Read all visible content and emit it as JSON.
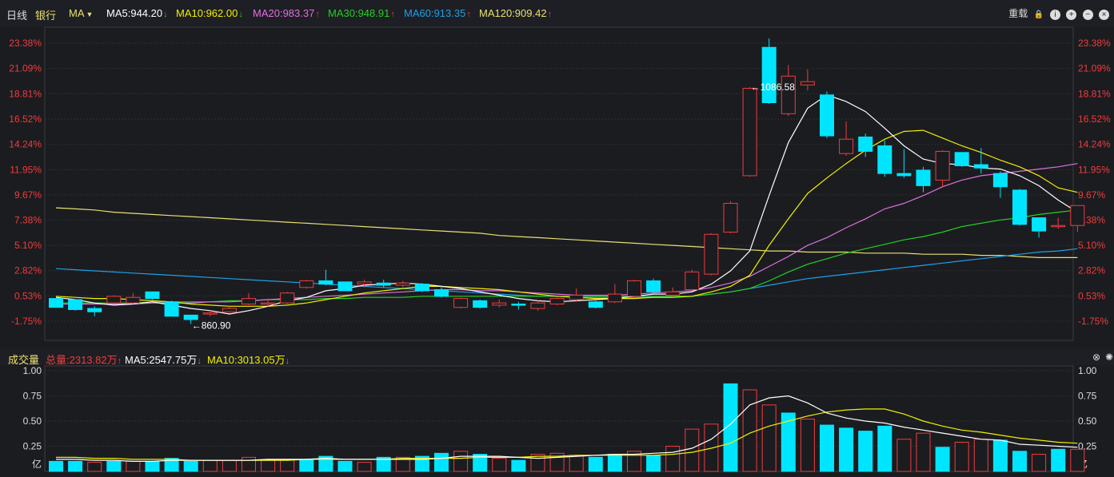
{
  "header": {
    "period": "日线",
    "sector": "银行",
    "indicator": "MA",
    "ma": [
      {
        "label": "MA5:944.20",
        "color": "#ffffff",
        "arrow": "↓",
        "dir": "dn"
      },
      {
        "label": "MA10:962.00",
        "color": "#f0f000",
        "arrow": "↓",
        "dir": "dn"
      },
      {
        "label": "MA20:983.37",
        "color": "#e070e0",
        "arrow": "↑",
        "dir": "up"
      },
      {
        "label": "MA30:948.91",
        "color": "#23d023",
        "arrow": "↑",
        "dir": "up"
      },
      {
        "label": "MA60:913.35",
        "color": "#1ea0e6",
        "arrow": "↑",
        "dir": "up"
      },
      {
        "label": "MA120:909.42",
        "color": "#e8e070",
        "arrow": "↑",
        "dir": "up"
      }
    ],
    "reload_label": "重载"
  },
  "volume_header": {
    "title": "成交量",
    "total": "总量:2313.82万",
    "total_arrow": "↑",
    "ma5": "MA5:2547.75万",
    "ma5_arrow": "↓",
    "ma10": "MA10:3013.05万",
    "ma10_arrow": "↓",
    "unit": "亿"
  },
  "colors": {
    "up": "#f03c3c",
    "down": "#00e5ff",
    "ma5": "#ffffff",
    "ma10": "#f0f000",
    "ma20": "#e070e0",
    "ma30": "#23d023",
    "ma60": "#1ea0e6",
    "ma120": "#e8e070"
  },
  "chart_data": [
    {
      "type": "candlestick",
      "y_ticks": [
        "23.38%",
        "21.09%",
        "18.81%",
        "16.52%",
        "14.24%",
        "11.95%",
        "9.67%",
        "7.38%",
        "5.10%",
        "2.82%",
        "0.53%",
        "-1.75%"
      ],
      "ylim_pct": [
        -3,
        26.5
      ],
      "annotations": [
        {
          "label": "←1086.58",
          "index": 36
        },
        {
          "label": "←860.90",
          "index": 7
        }
      ],
      "candles": [
        {
          "o": 0.3,
          "c": -0.5,
          "h": 0.3,
          "l": -0.5
        },
        {
          "o": 0.2,
          "c": -0.7,
          "h": 0.2,
          "l": -0.8
        },
        {
          "o": -0.6,
          "c": -0.9,
          "h": -0.4,
          "l": -1.3
        },
        {
          "o": -0.1,
          "c": 0.5,
          "h": 0.6,
          "l": -0.1
        },
        {
          "o": -0.1,
          "c": 0.4,
          "h": 0.8,
          "l": -0.2
        },
        {
          "o": 0.9,
          "c": 0.3,
          "h": 0.9,
          "l": 0.2
        },
        {
          "o": 0.0,
          "c": -1.3,
          "h": 0.1,
          "l": -1.3
        },
        {
          "o": -1.2,
          "c": -1.6,
          "h": -1.2,
          "l": -2.0
        },
        {
          "o": -1.1,
          "c": -1.0,
          "h": -0.8,
          "l": -1.3
        },
        {
          "o": -0.9,
          "c": -0.6,
          "h": -0.4,
          "l": -1.0
        },
        {
          "o": -0.2,
          "c": 0.3,
          "h": 0.8,
          "l": -0.3
        },
        {
          "o": -0.2,
          "c": -0.1,
          "h": 0.3,
          "l": -0.4
        },
        {
          "o": -0.1,
          "c": 0.8,
          "h": 0.9,
          "l": -0.2
        },
        {
          "o": 1.3,
          "c": 1.9,
          "h": 2.0,
          "l": 1.2
        },
        {
          "o": 1.9,
          "c": 1.6,
          "h": 2.9,
          "l": 1.5
        },
        {
          "o": 1.8,
          "c": 1.0,
          "h": 1.8,
          "l": 1.0
        },
        {
          "o": 1.6,
          "c": 1.8,
          "h": 2.0,
          "l": 1.3
        },
        {
          "o": 1.7,
          "c": 1.5,
          "h": 2.0,
          "l": 1.3
        },
        {
          "o": 1.5,
          "c": 1.7,
          "h": 1.9,
          "l": 1.3
        },
        {
          "o": 1.6,
          "c": 1.0,
          "h": 1.7,
          "l": 0.9
        },
        {
          "o": 1.1,
          "c": 0.5,
          "h": 1.4,
          "l": 0.4
        },
        {
          "o": -0.5,
          "c": 0.3,
          "h": 0.4,
          "l": -0.6
        },
        {
          "o": 0.1,
          "c": -0.5,
          "h": 0.2,
          "l": -0.6
        },
        {
          "o": -0.3,
          "c": -0.1,
          "h": 0.2,
          "l": -0.5
        },
        {
          "o": -0.2,
          "c": -0.3,
          "h": 0.0,
          "l": -0.7
        },
        {
          "o": -0.6,
          "c": -0.1,
          "h": 0.1,
          "l": -0.8
        },
        {
          "o": -0.2,
          "c": 0.3,
          "h": 0.4,
          "l": -0.3
        },
        {
          "o": 0.2,
          "c": 0.6,
          "h": 1.2,
          "l": 0.0
        },
        {
          "o": 0.0,
          "c": -0.5,
          "h": 0.1,
          "l": -0.6
        },
        {
          "o": 0.0,
          "c": 0.7,
          "h": 1.6,
          "l": -0.1
        },
        {
          "o": 0.5,
          "c": 1.9,
          "h": 2.0,
          "l": 0.4
        },
        {
          "o": 1.9,
          "c": 0.9,
          "h": 2.1,
          "l": 0.8
        },
        {
          "o": 0.6,
          "c": 0.9,
          "h": 1.3,
          "l": 0.4
        },
        {
          "o": 1.1,
          "c": 2.7,
          "h": 2.9,
          "l": 1.0
        },
        {
          "o": 2.5,
          "c": 6.1,
          "h": 6.2,
          "l": 2.4
        },
        {
          "o": 6.3,
          "c": 8.9,
          "h": 9.1,
          "l": 6.2
        },
        {
          "o": 11.4,
          "c": 19.3,
          "h": 19.4,
          "l": 11.3
        },
        {
          "o": 23.0,
          "c": 18.0,
          "h": 23.8,
          "l": 17.9
        },
        {
          "o": 17.0,
          "c": 20.4,
          "h": 21.4,
          "l": 16.8
        },
        {
          "o": 19.6,
          "c": 19.9,
          "h": 21.0,
          "l": 19.1
        },
        {
          "o": 18.7,
          "c": 15.0,
          "h": 19.0,
          "l": 14.8
        },
        {
          "o": 13.4,
          "c": 14.7,
          "h": 16.3,
          "l": 13.2
        },
        {
          "o": 14.9,
          "c": 13.6,
          "h": 15.2,
          "l": 13.1
        },
        {
          "o": 14.1,
          "c": 11.6,
          "h": 14.6,
          "l": 11.3
        },
        {
          "o": 11.6,
          "c": 11.4,
          "h": 13.8,
          "l": 11.2
        },
        {
          "o": 11.9,
          "c": 10.5,
          "h": 12.2,
          "l": 9.9
        },
        {
          "o": 11.0,
          "c": 13.6,
          "h": 13.7,
          "l": 10.4
        },
        {
          "o": 13.5,
          "c": 12.3,
          "h": 13.5,
          "l": 12.2
        },
        {
          "o": 12.4,
          "c": 12.1,
          "h": 13.9,
          "l": 11.6
        },
        {
          "o": 11.6,
          "c": 10.4,
          "h": 11.8,
          "l": 9.4
        },
        {
          "o": 10.1,
          "c": 7.0,
          "h": 10.2,
          "l": 6.9
        },
        {
          "o": 7.6,
          "c": 6.4,
          "h": 7.6,
          "l": 5.8
        },
        {
          "o": 6.9,
          "c": 6.9,
          "h": 7.6,
          "l": 6.6
        },
        {
          "o": 6.9,
          "c": 8.7,
          "h": 8.7,
          "l": 6.3
        }
      ],
      "ma5": [
        0.4,
        0.2,
        -0.1,
        -0.3,
        -0.2,
        0.0,
        -0.3,
        -0.6,
        -0.8,
        -1.1,
        -0.8,
        -0.4,
        0.1,
        0.4,
        1.0,
        1.2,
        1.5,
        1.6,
        1.7,
        1.6,
        1.4,
        1.2,
        0.9,
        0.6,
        0.3,
        0.1,
        0.0,
        0.1,
        0.2,
        0.3,
        0.5,
        0.7,
        0.7,
        0.9,
        1.6,
        2.8,
        4.6,
        9.6,
        14.4,
        17.5,
        18.7,
        18.1,
        17.2,
        15.7,
        14.1,
        12.9,
        12.5,
        12.4,
        12.1,
        12.0,
        11.4,
        10.5,
        9.2,
        8.1
      ],
      "ma10": [
        0.5,
        0.4,
        0.3,
        0.3,
        0.2,
        0.1,
        0.0,
        -0.2,
        -0.3,
        -0.4,
        -0.4,
        -0.4,
        -0.3,
        -0.1,
        0.2,
        0.5,
        0.8,
        1.0,
        1.2,
        1.4,
        1.4,
        1.3,
        1.2,
        1.1,
        0.9,
        0.7,
        0.5,
        0.4,
        0.3,
        0.3,
        0.3,
        0.4,
        0.4,
        0.5,
        0.9,
        1.4,
        2.4,
        5.1,
        7.5,
        9.8,
        11.2,
        12.5,
        13.7,
        14.7,
        15.4,
        15.5,
        14.8,
        14.1,
        13.5,
        12.8,
        12.2,
        11.4,
        10.3,
        9.9
      ],
      "ma20": [
        -0.2,
        -0.2,
        -0.2,
        -0.2,
        -0.2,
        -0.1,
        -0.1,
        -0.1,
        0.0,
        0.0,
        0.1,
        0.2,
        0.3,
        0.4,
        0.5,
        0.6,
        0.7,
        0.8,
        0.9,
        1.0,
        1.1,
        1.1,
        1.0,
        1.0,
        0.9,
        0.8,
        0.7,
        0.6,
        0.6,
        0.6,
        0.7,
        0.8,
        0.9,
        1.0,
        1.3,
        1.7,
        2.3,
        3.2,
        4.1,
        5.1,
        5.8,
        6.7,
        7.5,
        8.4,
        8.9,
        9.6,
        10.4,
        11.0,
        11.4,
        11.6,
        11.8,
        12.0,
        12.2,
        12.5
      ],
      "ma30": [
        -0.1,
        -0.1,
        -0.1,
        -0.1,
        -0.1,
        0.0,
        0.0,
        0.0,
        0.0,
        0.1,
        0.1,
        0.2,
        0.2,
        0.2,
        0.3,
        0.3,
        0.4,
        0.4,
        0.4,
        0.5,
        0.5,
        0.5,
        0.5,
        0.5,
        0.5,
        0.5,
        0.5,
        0.5,
        0.5,
        0.5,
        0.5,
        0.5,
        0.5,
        0.5,
        0.7,
        0.9,
        1.2,
        1.9,
        2.7,
        3.4,
        3.9,
        4.4,
        4.8,
        5.2,
        5.6,
        5.9,
        6.3,
        6.8,
        7.1,
        7.4,
        7.6,
        7.9,
        8.1,
        8.3
      ],
      "ma60": [
        3.0,
        2.9,
        2.8,
        2.7,
        2.6,
        2.5,
        2.4,
        2.3,
        2.2,
        2.1,
        2.0,
        1.9,
        1.8,
        1.7,
        1.6,
        1.5,
        1.4,
        1.3,
        1.2,
        1.1,
        1.0,
        0.9,
        0.8,
        0.7,
        0.6,
        0.5,
        0.5,
        0.4,
        0.4,
        0.4,
        0.4,
        0.4,
        0.4,
        0.5,
        0.7,
        0.9,
        1.2,
        1.5,
        1.8,
        2.1,
        2.3,
        2.5,
        2.7,
        2.9,
        3.1,
        3.3,
        3.5,
        3.7,
        3.9,
        4.1,
        4.3,
        4.5,
        4.6,
        4.8
      ],
      "ma120": [
        8.5,
        8.4,
        8.3,
        8.1,
        8.0,
        7.9,
        7.8,
        7.7,
        7.6,
        7.5,
        7.4,
        7.3,
        7.2,
        7.1,
        7.0,
        6.9,
        6.8,
        6.7,
        6.6,
        6.5,
        6.4,
        6.3,
        6.2,
        6.0,
        5.9,
        5.8,
        5.7,
        5.6,
        5.5,
        5.4,
        5.3,
        5.2,
        5.1,
        5.0,
        4.9,
        4.8,
        4.7,
        4.6,
        4.6,
        4.5,
        4.5,
        4.5,
        4.4,
        4.4,
        4.4,
        4.3,
        4.3,
        4.3,
        4.2,
        4.2,
        4.1,
        4.0,
        4.0,
        4.0
      ]
    },
    {
      "type": "bar",
      "y_ticks": [
        "1.00",
        "0.75",
        "0.50",
        "0.25"
      ],
      "ylim": [
        0,
        1.0
      ],
      "unit": "亿",
      "volumes": [
        0.1,
        0.1,
        0.09,
        0.1,
        0.1,
        0.1,
        0.13,
        0.1,
        0.11,
        0.11,
        0.14,
        0.11,
        0.12,
        0.12,
        0.15,
        0.1,
        0.09,
        0.14,
        0.14,
        0.15,
        0.18,
        0.2,
        0.17,
        0.13,
        0.11,
        0.17,
        0.18,
        0.16,
        0.14,
        0.17,
        0.2,
        0.16,
        0.25,
        0.42,
        0.47,
        0.87,
        0.81,
        0.66,
        0.58,
        0.52,
        0.46,
        0.43,
        0.4,
        0.45,
        0.32,
        0.38,
        0.24,
        0.29,
        0.32,
        0.31,
        0.2,
        0.17,
        0.22,
        0.22
      ],
      "vol_up": [
        false,
        false,
        true,
        false,
        true,
        false,
        false,
        false,
        true,
        true,
        true,
        true,
        true,
        false,
        false,
        false,
        true,
        false,
        true,
        false,
        false,
        true,
        false,
        true,
        false,
        true,
        true,
        true,
        false,
        false,
        true,
        false,
        true,
        true,
        true,
        false,
        true,
        true,
        false,
        true,
        false,
        false,
        false,
        false,
        true,
        true,
        false,
        true,
        true,
        false,
        false,
        true,
        false,
        true
      ],
      "vma5": [
        0.12,
        0.12,
        0.11,
        0.11,
        0.1,
        0.1,
        0.11,
        0.11,
        0.11,
        0.11,
        0.11,
        0.12,
        0.12,
        0.12,
        0.13,
        0.12,
        0.12,
        0.12,
        0.12,
        0.12,
        0.13,
        0.15,
        0.15,
        0.15,
        0.14,
        0.13,
        0.14,
        0.15,
        0.16,
        0.17,
        0.17,
        0.18,
        0.19,
        0.23,
        0.32,
        0.47,
        0.66,
        0.73,
        0.75,
        0.68,
        0.58,
        0.53,
        0.5,
        0.48,
        0.44,
        0.41,
        0.38,
        0.35,
        0.32,
        0.31,
        0.27,
        0.26,
        0.25,
        0.24
      ],
      "vma10": [
        0.14,
        0.14,
        0.13,
        0.13,
        0.12,
        0.12,
        0.12,
        0.11,
        0.11,
        0.11,
        0.11,
        0.11,
        0.11,
        0.12,
        0.12,
        0.12,
        0.12,
        0.12,
        0.13,
        0.13,
        0.13,
        0.13,
        0.14,
        0.14,
        0.14,
        0.15,
        0.15,
        0.16,
        0.16,
        0.16,
        0.16,
        0.16,
        0.17,
        0.19,
        0.23,
        0.28,
        0.38,
        0.45,
        0.5,
        0.55,
        0.59,
        0.61,
        0.62,
        0.62,
        0.57,
        0.5,
        0.45,
        0.41,
        0.39,
        0.36,
        0.33,
        0.31,
        0.29,
        0.28
      ]
    }
  ]
}
